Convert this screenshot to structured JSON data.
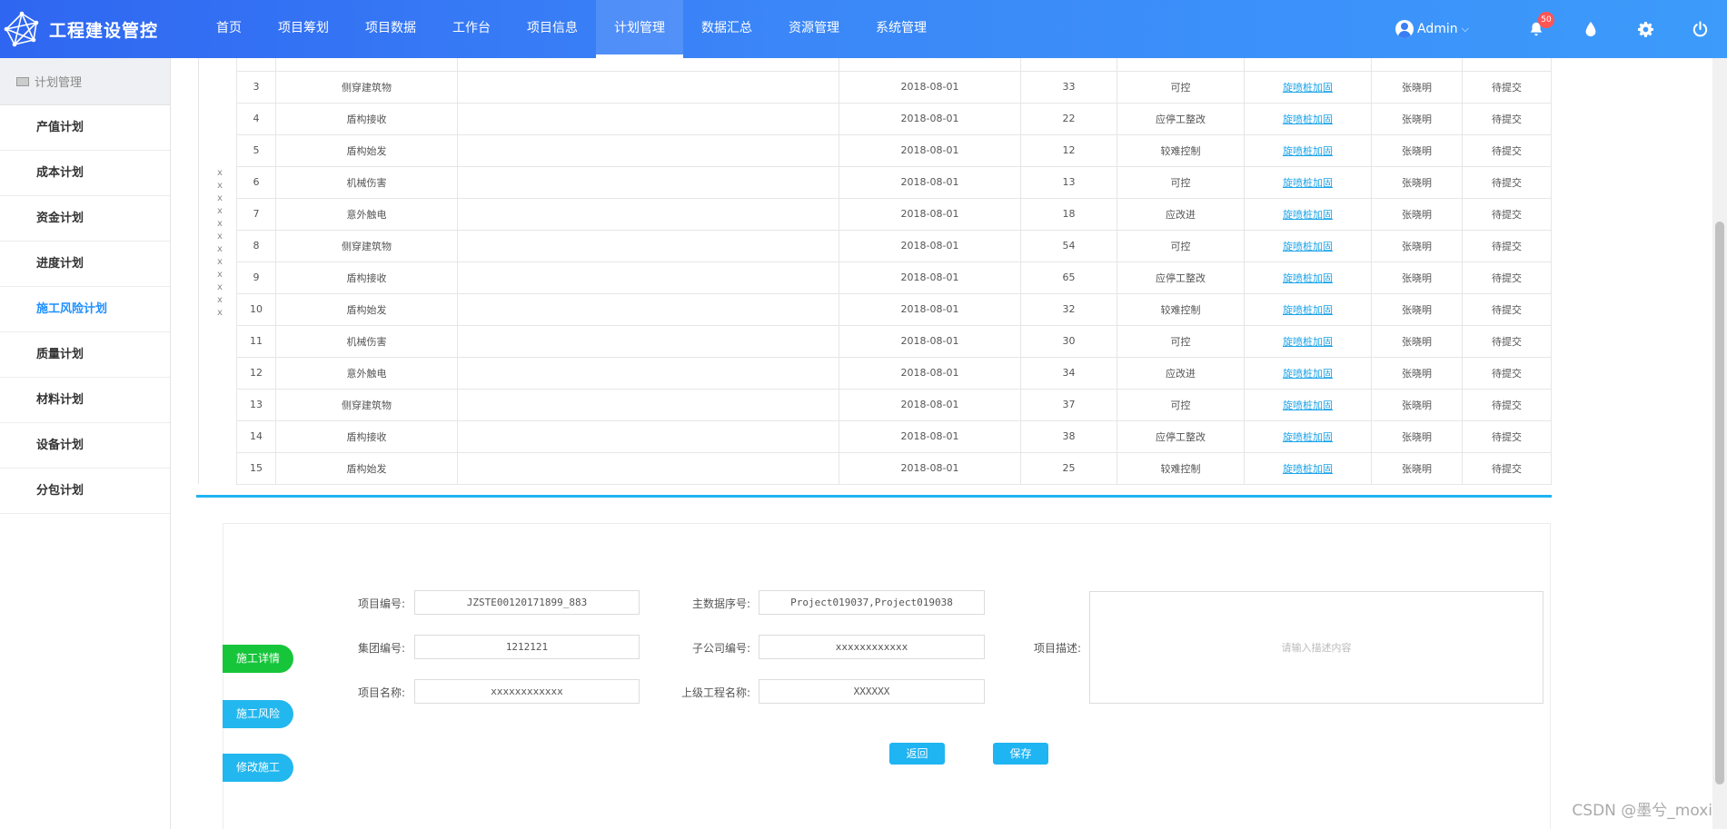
{
  "app": {
    "title": "工程建设管控"
  },
  "nav": [
    {
      "label": "首页"
    },
    {
      "label": "项目筹划"
    },
    {
      "label": "项目数据"
    },
    {
      "label": "工作台"
    },
    {
      "label": "项目信息"
    },
    {
      "label": "计划管理"
    },
    {
      "label": "数据汇总"
    },
    {
      "label": "资源管理"
    },
    {
      "label": "系统管理"
    }
  ],
  "nav_active": "计划管理",
  "user": {
    "name": "Admin"
  },
  "notifications": {
    "count": "50"
  },
  "sidebar": {
    "header": "计划管理",
    "items": [
      {
        "label": "产值计划"
      },
      {
        "label": "成本计划"
      },
      {
        "label": "资金计划"
      },
      {
        "label": "进度计划"
      },
      {
        "label": "施工风险计划"
      },
      {
        "label": "质量计划"
      },
      {
        "label": "材料计划"
      },
      {
        "label": "设备计划"
      },
      {
        "label": "分包计划"
      }
    ],
    "active": "施工风险计划"
  },
  "x_markers": [
    "x",
    "x",
    "x",
    "x",
    "x",
    "x",
    "x",
    "x",
    "x",
    "x",
    "x",
    "x"
  ],
  "table": {
    "rows": [
      {
        "idx": "3",
        "name": "侧穿建筑物",
        "desc": "",
        "date": "2018-08-01",
        "num": "33",
        "level": "可控",
        "link": "旋喷桩加固",
        "person": "张晓明",
        "status": "待提交"
      },
      {
        "idx": "4",
        "name": "盾构接收",
        "desc": "",
        "date": "2018-08-01",
        "num": "22",
        "level": "应停工整改",
        "link": "旋喷桩加固",
        "person": "张晓明",
        "status": "待提交"
      },
      {
        "idx": "5",
        "name": "盾构始发",
        "desc": "",
        "date": "2018-08-01",
        "num": "12",
        "level": "较难控制",
        "link": "旋喷桩加固",
        "person": "张晓明",
        "status": "待提交"
      },
      {
        "idx": "6",
        "name": "机械伤害",
        "desc": "",
        "date": "2018-08-01",
        "num": "13",
        "level": "可控",
        "link": "旋喷桩加固",
        "person": "张晓明",
        "status": "待提交"
      },
      {
        "idx": "7",
        "name": "意外触电",
        "desc": "",
        "date": "2018-08-01",
        "num": "18",
        "level": "应改进",
        "link": "旋喷桩加固",
        "person": "张晓明",
        "status": "待提交"
      },
      {
        "idx": "8",
        "name": "侧穿建筑物",
        "desc": "",
        "date": "2018-08-01",
        "num": "54",
        "level": "可控",
        "link": "旋喷桩加固",
        "person": "张晓明",
        "status": "待提交"
      },
      {
        "idx": "9",
        "name": "盾构接收",
        "desc": "",
        "date": "2018-08-01",
        "num": "65",
        "level": "应停工整改",
        "link": "旋喷桩加固",
        "person": "张晓明",
        "status": "待提交"
      },
      {
        "idx": "10",
        "name": "盾构始发",
        "desc": "",
        "date": "2018-08-01",
        "num": "32",
        "level": "较难控制",
        "link": "旋喷桩加固",
        "person": "张晓明",
        "status": "待提交"
      },
      {
        "idx": "11",
        "name": "机械伤害",
        "desc": "",
        "date": "2018-08-01",
        "num": "30",
        "level": "可控",
        "link": "旋喷桩加固",
        "person": "张晓明",
        "status": "待提交"
      },
      {
        "idx": "12",
        "name": "意外触电",
        "desc": "",
        "date": "2018-08-01",
        "num": "34",
        "level": "应改进",
        "link": "旋喷桩加固",
        "person": "张晓明",
        "status": "待提交"
      },
      {
        "idx": "13",
        "name": "侧穿建筑物",
        "desc": "",
        "date": "2018-08-01",
        "num": "37",
        "level": "可控",
        "link": "旋喷桩加固",
        "person": "张晓明",
        "status": "待提交"
      },
      {
        "idx": "14",
        "name": "盾构接收",
        "desc": "",
        "date": "2018-08-01",
        "num": "38",
        "level": "应停工整改",
        "link": "旋喷桩加固",
        "person": "张晓明",
        "status": "待提交"
      },
      {
        "idx": "15",
        "name": "盾构始发",
        "desc": "",
        "date": "2018-08-01",
        "num": "25",
        "level": "较难控制",
        "link": "旋喷桩加固",
        "person": "张晓明",
        "status": "待提交"
      }
    ]
  },
  "side_tabs": {
    "detail": "施工详情",
    "risk": "施工风险",
    "modify": "修改施工"
  },
  "form": {
    "project_no_label": "项目编号:",
    "project_no": "JZSTE00120171899_883",
    "group_no_label": "集团编号:",
    "group_no": "1212121",
    "project_name_label": "项目名称:",
    "project_name": "xxxxxxxxxxxx",
    "main_seq_label": "主数据序号:",
    "main_seq": "Project019037,Project019038",
    "sub_company_label": "子公司编号:",
    "sub_company": "xxxxxxxxxxxx",
    "parent_project_label": "上级工程名称:",
    "parent_project": "XXXXXX",
    "desc_label": "项目描述:",
    "desc_placeholder": "请输入描述内容",
    "back_label": "返回",
    "save_label": "保存"
  },
  "watermark": "CSDN @墨兮_moxi",
  "colors": {
    "header_start": "#2f66f1",
    "header_end": "#3c9bfb",
    "accent": "#1fb4f2",
    "green": "#16c53a",
    "link": "#1aa3e8",
    "badge": "#ff5555"
  }
}
